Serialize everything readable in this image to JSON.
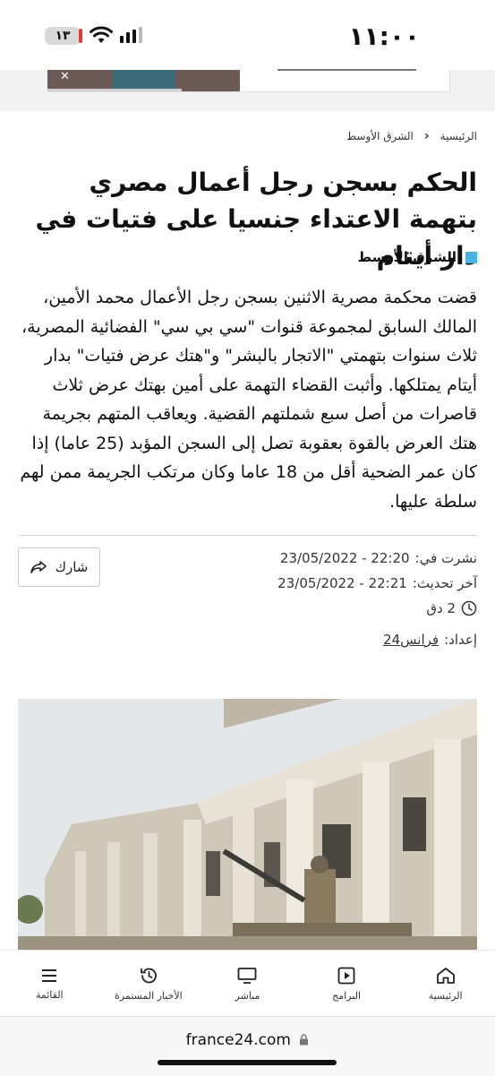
{
  "status_bar": {
    "time": "١١:٠٠",
    "battery": "١٣"
  },
  "breadcrumb": {
    "home": "الرئيسية",
    "section": "الشرق الأوسط"
  },
  "article": {
    "title": "الحكم بسجن رجل أعمال مصري بتهمة الاعتداء جنسيا على فتيات في دار أيتام",
    "section": "الشرق الأوسط",
    "body": "قضت محكمة مصرية الاثنين بسجن رجل الأعمال محمد الأمين، المالك السابق لمجموعة قنوات \"سي بي سي\" الفضائية المصرية، ثلاث سنوات بتهمتي \"الاتجار بالبشر\" و\"هتك عرض فتيات\" بدار أيتام يمتلكها. وأثبت القضاء التهمة على أمين بهتك عرض ثلاث قاصرات من أصل سبع شملتهم القضية. ويعاقب المتهم بجريمة هتك العرض بالقوة بعقوبة تصل إلى السجن المؤبد (25 عاما) إذا كان عمر الضحية أقل من 18 عاما وكان مرتكب الجريمة ممن لهم سلطة عليها.",
    "share_label": "شارك",
    "published_label": "نشرت في:",
    "published_value": "23/05/2022 - 22:20",
    "updated_label": "آخر تحديث:",
    "updated_value": "23/05/2022 - 22:21",
    "read_time": "2 دق",
    "author_label": "إعداد:",
    "author": "فرانس24"
  },
  "bottom_nav": {
    "items": [
      {
        "label": "الرئيسية",
        "icon": "home-icon"
      },
      {
        "label": "البرامج",
        "icon": "play-icon"
      },
      {
        "label": "مباشر",
        "icon": "tv-icon"
      },
      {
        "label": "الأخبار المستمرة",
        "icon": "history-icon"
      },
      {
        "label": "القائمة",
        "icon": "menu-icon"
      }
    ]
  },
  "url_bar": {
    "domain": "france24.com"
  },
  "colors": {
    "accent": "#4ab3e6"
  }
}
